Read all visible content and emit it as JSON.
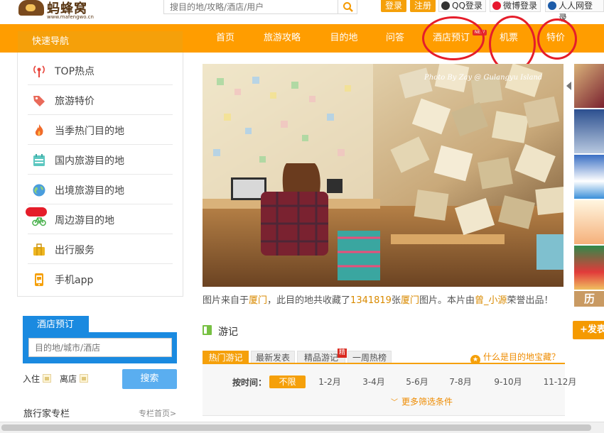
{
  "header": {
    "logo_text": "蚂蜂窝",
    "logo_url": "www.mafengwo.cn",
    "search_placeholder": "搜目的地/攻略/酒店/用户",
    "login_label": "登录",
    "register_label": "注册",
    "qq_login": "QQ登录",
    "weibo_login": "微博登录",
    "renren_login": "人人网登录"
  },
  "nav": {
    "quick_nav_title": "快速导航",
    "items": [
      "首页",
      "旅游攻略",
      "目的地",
      "问答",
      "酒店预订",
      "机票",
      "特价"
    ],
    "new_badge": "NEW"
  },
  "sidebar": {
    "items": [
      {
        "label": "TOP热点",
        "icon": "broadcast-icon"
      },
      {
        "label": "旅游特价",
        "icon": "price-tag-icon"
      },
      {
        "label": "当季热门目的地",
        "icon": "fire-icon"
      },
      {
        "label": "国内旅游目的地",
        "icon": "calendar-icon"
      },
      {
        "label": "出境旅游目的地",
        "icon": "globe-icon"
      },
      {
        "label": "周边游目的地",
        "icon": "bicycle-icon"
      },
      {
        "label": "出行服务",
        "icon": "suitcase-icon"
      },
      {
        "label": "手机app",
        "icon": "phone-icon"
      }
    ]
  },
  "hero": {
    "watermark": "Photo By Zay @ Gulangyu Island",
    "caption_prefix": "图片来自于",
    "caption_place": "厦门",
    "caption_mid1": "，此目的地共收藏了",
    "caption_count": "1341819",
    "caption_mid2": "张",
    "caption_place2": "厦门",
    "caption_mid3": "图片。本片由",
    "caption_author": "曾_小源",
    "caption_suffix": "荣誉出品！",
    "thumb_label": "历"
  },
  "youji": {
    "title": "游记",
    "post_button": "+发表",
    "tabs": [
      "热门游记",
      "最新发表",
      "精品游记",
      "一周热榜"
    ],
    "jing_badge": "精",
    "treasure_link": "什么是目的地宝藏？",
    "time_label": "按时间：",
    "time_options": [
      "不限",
      "1-2月",
      "3-4月",
      "5-6月",
      "7-8月",
      "9-10月",
      "11-12月"
    ],
    "more_filters": "更多筛选条件"
  },
  "hotel": {
    "tab_label": "酒店预订",
    "input_placeholder": "目的地/城市/酒店",
    "checkin_label": "入住",
    "checkout_label": "离店",
    "search_button": "搜索"
  },
  "column": {
    "title": "旅行家专栏",
    "link": "专栏首页>"
  },
  "colors": {
    "brand_orange": "#ff9d00",
    "annotation_red": "#e51d2a",
    "hotel_blue": "#1a8ae0"
  }
}
